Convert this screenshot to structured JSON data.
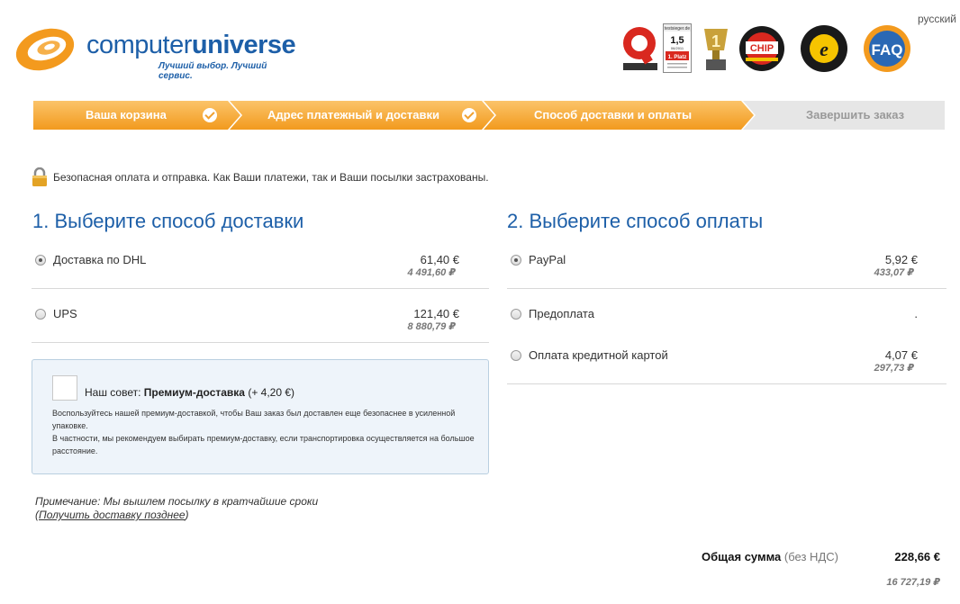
{
  "header": {
    "language": "русский",
    "logo": {
      "name": "computeruniverse",
      "name_light": "computer",
      "name_bold": "universe",
      "slogan": "Лучший выбор. Лучший сервис."
    },
    "badges": [
      {
        "icon": "q-award-icon"
      },
      {
        "icon": "testsieger-icon",
        "site": "testsieger.de",
        "grade": "1,5",
        "date": "06/2011",
        "rank": "1. Platz"
      },
      {
        "icon": "trophy-icon"
      },
      {
        "icon": "chip-certificate-icon",
        "text": "CHIP"
      },
      {
        "icon": "trusted-shops-icon",
        "text": "e"
      },
      {
        "icon": "faq-icon",
        "text": "FAQ"
      }
    ]
  },
  "steps": [
    {
      "label": "Ваша корзина",
      "done": true
    },
    {
      "label": "Адрес платежный и доставки",
      "done": true
    },
    {
      "label": "Способ доставки и оплаты",
      "done": false,
      "active": true
    },
    {
      "label": "Завершить заказ",
      "done": false
    }
  ],
  "security_note": "Безопасная оплата и отправка. Как Ваши платежи, так и Ваши посылки застрахованы.",
  "delivery": {
    "title": "1. Выберите способ доставки",
    "options": [
      {
        "label": "Доставка по DHL",
        "price": "61,40 €",
        "price_rub": "4 491,60 ₽",
        "selected": true
      },
      {
        "label": "UPS",
        "price": "121,40 €",
        "price_rub": "8 880,79 ₽",
        "selected": false
      }
    ],
    "tip": {
      "prefix": "Наш совет: ",
      "name": "Премиум-доставка",
      "extra": " (+ 4,20 €)",
      "body_1": "Воспользуйтесь нашей премиум-доставкой, чтобы Ваш заказ был доставлен еще безопаснее в усиленной упаковке.",
      "body_2": "В частности, мы рекомендуем выбирать премиум-доставку, если транспортировка осуществляется на большое расстояние."
    },
    "note": "Примечание: Мы вышлем посылку в кратчайшие сроки",
    "note_link": "Получить доставку позднее"
  },
  "payment": {
    "title": "2. Выберите способ оплаты",
    "options": [
      {
        "label": "PayPal",
        "price": "5,92 €",
        "price_rub": "433,07 ₽",
        "selected": true
      },
      {
        "label": "Предоплата",
        "price": ".",
        "price_rub": "",
        "selected": false
      },
      {
        "label": "Оплата кредитной картой",
        "price": "4,07 €",
        "price_rub": "297,73 ₽",
        "selected": false
      }
    ]
  },
  "total": {
    "label": "Общая сумма",
    "vat": "(без НДС)",
    "value": "228,66 €",
    "value_rub": "16 727,19 ₽"
  },
  "colors": {
    "accent_blue": "#1d5fa8",
    "step_orange": "#f5a623",
    "step_grey": "#e6e6e6"
  }
}
